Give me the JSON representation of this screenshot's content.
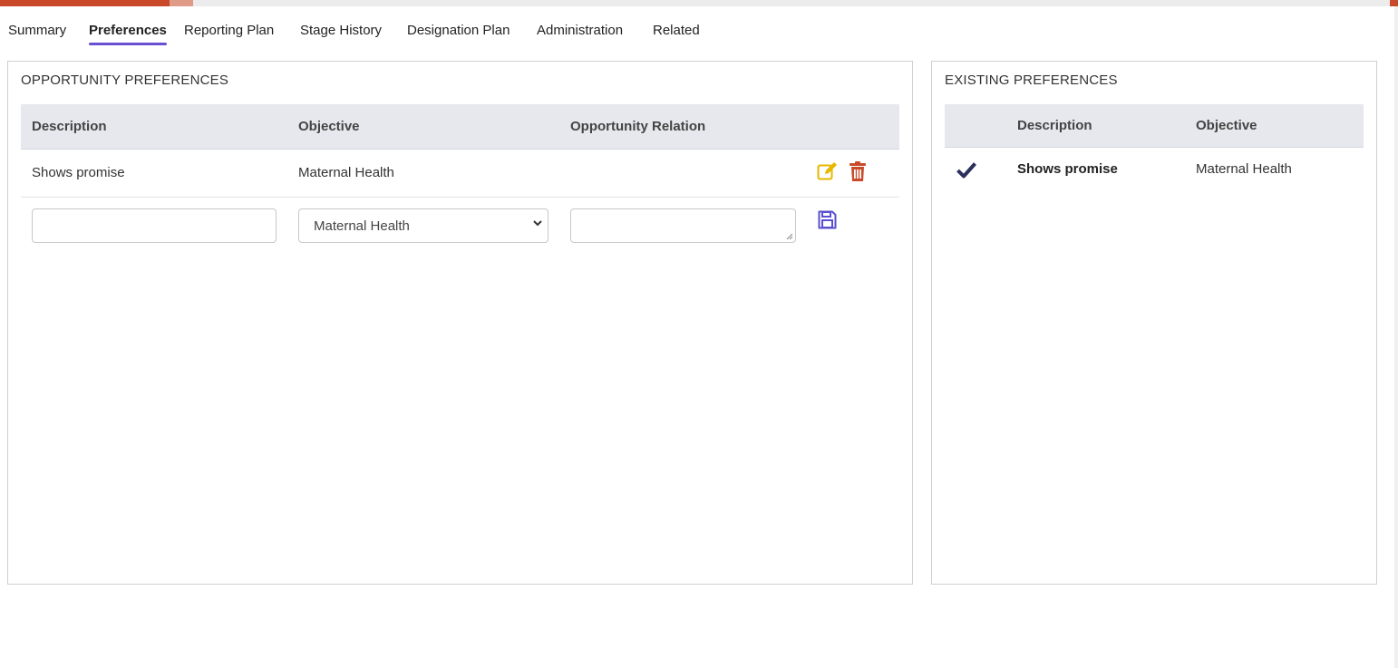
{
  "progress": {
    "fraction": 0.121
  },
  "tabs": [
    {
      "label": "Summary",
      "active": false
    },
    {
      "label": "Preferences",
      "active": true
    },
    {
      "label": "Reporting Plan",
      "active": false
    },
    {
      "label": "Stage History",
      "active": false
    },
    {
      "label": "Designation Plan",
      "active": false
    },
    {
      "label": "Administration",
      "active": false
    },
    {
      "label": "Related",
      "active": false
    }
  ],
  "opportunity_preferences": {
    "title": "OPPORTUNITY PREFERENCES",
    "columns": [
      "Description",
      "Objective",
      "Opportunity Relation"
    ],
    "rows": [
      {
        "description": "Shows promise",
        "objective": "Maternal Health",
        "relation": ""
      }
    ],
    "new_row": {
      "description_value": "",
      "objective_selected": "Maternal Health",
      "relation_value": ""
    },
    "icons": {
      "edit": "edit-icon",
      "delete": "trash-icon",
      "save": "save-icon"
    }
  },
  "existing_preferences": {
    "title": "EXISTING PREFERENCES",
    "columns": [
      "Description",
      "Objective"
    ],
    "rows": [
      {
        "checked": true,
        "description": "Shows promise",
        "objective": "Maternal Health"
      }
    ]
  },
  "colors": {
    "accent_tab_underline": "#6a4fd0",
    "progress": "#c94a2a",
    "edit_icon": "#e6b800",
    "delete_icon": "#c94a2a",
    "save_icon": "#5a4fcf",
    "check_icon": "#2b2f5c"
  }
}
